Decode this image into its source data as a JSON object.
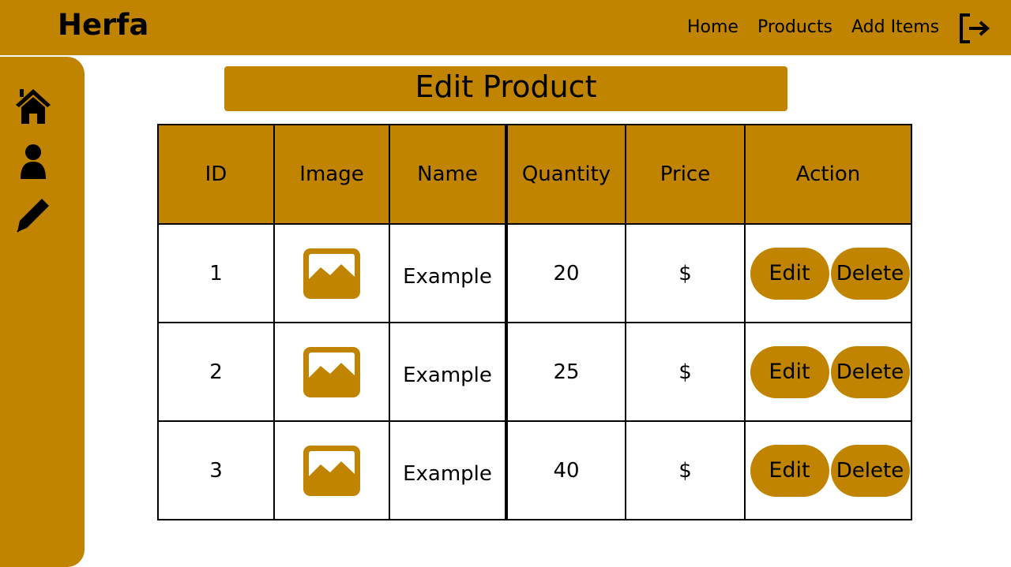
{
  "header": {
    "brand": "Herfa",
    "nav": {
      "home": "Home",
      "products": "Products",
      "add_items": "Add Items"
    },
    "logout_icon": "logout-icon"
  },
  "sidebar": {
    "icons": [
      "home-icon",
      "user-icon",
      "pen-icon"
    ]
  },
  "page": {
    "title": "Edit Product"
  },
  "table": {
    "columns": [
      "ID",
      "Image",
      "Name",
      "Quantity",
      "Price",
      "Action"
    ],
    "rows": [
      {
        "id": "1",
        "name": "Example",
        "quantity": "20",
        "price": "$",
        "edit": "Edit",
        "delete": "Delete"
      },
      {
        "id": "2",
        "name": "Example",
        "quantity": "25",
        "price": "$",
        "edit": "Edit",
        "delete": "Delete"
      },
      {
        "id": "3",
        "name": "Example",
        "quantity": "40",
        "price": "$",
        "edit": "Edit",
        "delete": "Delete"
      }
    ]
  },
  "colors": {
    "accent": "#c08400",
    "text": "#000000",
    "background": "#ffffff"
  }
}
